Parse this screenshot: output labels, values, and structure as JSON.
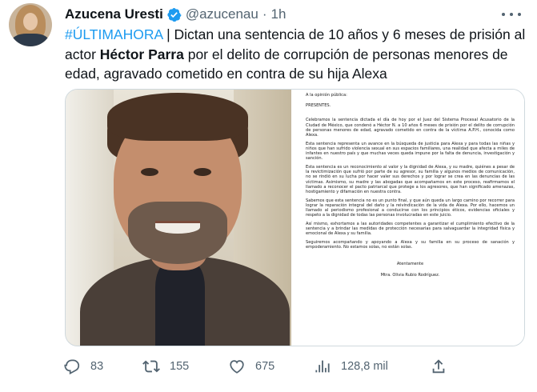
{
  "author": {
    "name": "Azucena Uresti",
    "handle": "@azucenau",
    "separator": "·",
    "time": "1h",
    "verified_color": "#1d9bf0"
  },
  "tweet": {
    "hashtag": "#ÚLTIMAHORA",
    "line1_rest": " | Dictan una sentencia de 10 años y 6 meses de prisión al",
    "line2_pre": "actor ",
    "line2_bold": "Héctor Parra",
    "line2_post": " por el delito de corrupción de personas menores de",
    "line3": "edad, agravado cometido en contra de su hija Alexa"
  },
  "letter": {
    "p0": "A la opinión pública:",
    "p1": "PRESENTES.",
    "p2": "Celebramos la sentencia dictada el día de hoy por el Juez del Sistema Procesal Acusatorio de la Ciudad de México, que condenó a Héctor N. a 10 años 6 meses de prisión por el delito de corrupción de personas menores de edad, agravado cometido en contra de la víctima A.P.H., conocida como Alexa.",
    "p3": "Esta sentencia representa un avance en la búsqueda de justicia para Alexa y para todas las niñas y niños que han sufrido violencia sexual en sus espacios familiares, una realidad que afecta a miles de infantes en nuestro país y que muchas veces queda impune por la falta de denuncia, investigación y sanción.",
    "p4": "Esta sentencia es un reconocimiento al valor y la dignidad de Alexa, y su madre, quiénes a pesar de la revictimización que sufrió por parte de su agresor, su familia y algunos medios de comunicación, no se rindió en su lucha por hacer valer sus derechos y por lograr se crea en las denuncias de las víctimas. Asimismo, su madre y las abogadas que acompañamos en este proceso, reafirmamos el llamado a reconocer el pacto patriarcal que protege a los agresores, que han significado amenazas, hostigamiento y difamación en nuestra contra.",
    "p5": "Sabemos que esta sentencia no es un punto final, y que aún queda un largo camino por recorrer para lograr la reparación integral del daño y la reivindicación de la vida de Alexa. Por ello, hacemos un llamado al periodismo profesional a conducirse con los principios éticos, evidencias oficiales y respeto a la dignidad de todas las personas involucradas en este juicio.",
    "p6": "Así mismo, exhortamos a las autoridades competentes a garantizar el cumplimiento efectivo de la sentencia y a brindar las medidas de protección necesarias para salvaguardar la integridad física y emocional de Alexa y su familia.",
    "p7": "Seguiremos acompañando y apoyando a Alexa y su familia en su proceso de sanación y empoderamiento. No estamos solas, no están solas.",
    "closing": "Atentamente",
    "signature": "Mtra. Olivia Rubio Rodríguez."
  },
  "actions": {
    "replies": "83",
    "retweets": "155",
    "likes": "675",
    "views": "128,8 mil"
  },
  "icons": [
    "verified-badge-icon",
    "more-options-icon",
    "reply-icon",
    "retweet-icon",
    "like-icon",
    "views-icon",
    "share-icon"
  ]
}
